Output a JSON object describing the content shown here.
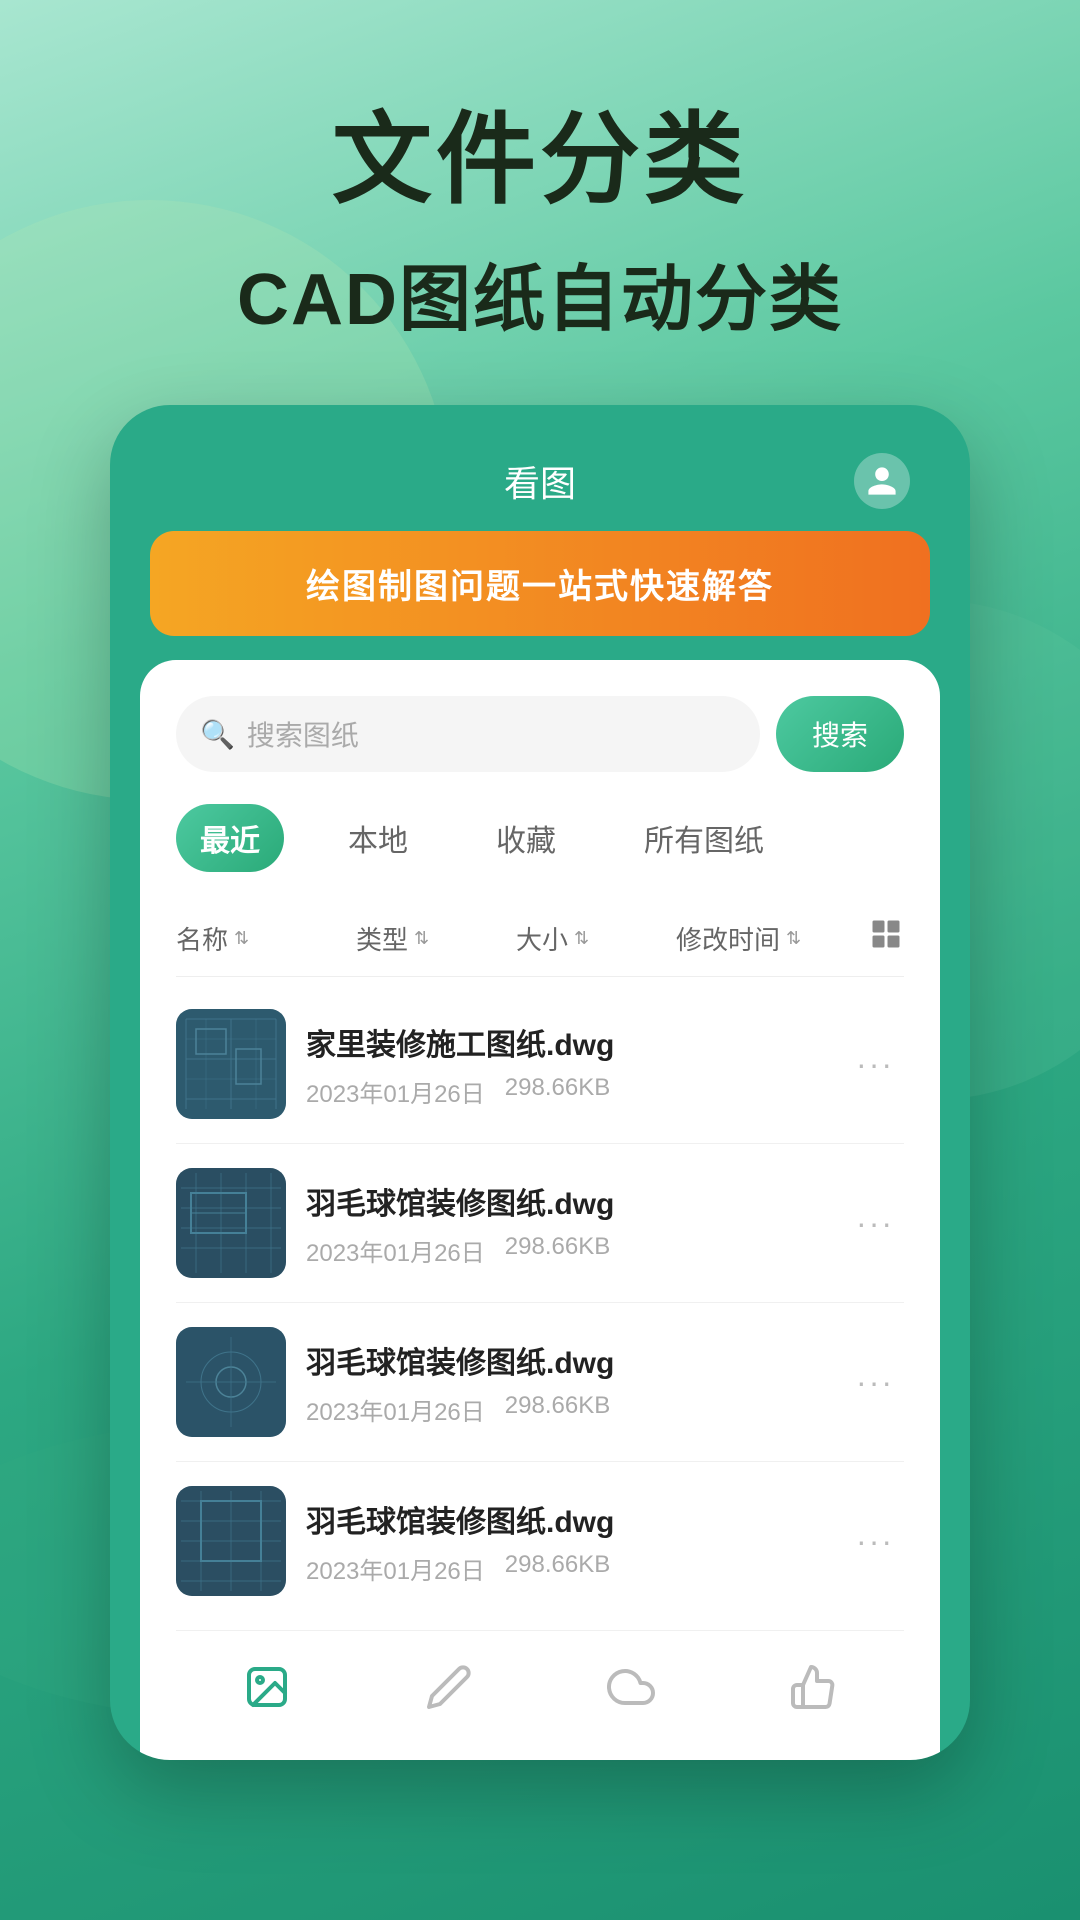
{
  "background": {
    "gradient_start": "#a8e6d0",
    "gradient_end": "#1a9070"
  },
  "title_section": {
    "main_title": "文件分类",
    "sub_title": "CAD图纸自动分类"
  },
  "app": {
    "header_title": "看图",
    "avatar_label": "用户头像"
  },
  "banner": {
    "text": "绘图制图问题一站式快速解答"
  },
  "search": {
    "placeholder": "搜索图纸",
    "button_label": "搜索"
  },
  "tabs": [
    {
      "id": "recent",
      "label": "最近",
      "active": true
    },
    {
      "id": "local",
      "label": "本地",
      "active": false
    },
    {
      "id": "favorite",
      "label": "收藏",
      "active": false
    },
    {
      "id": "all",
      "label": "所有图纸",
      "active": false
    }
  ],
  "sort_bar": {
    "columns": [
      {
        "id": "name",
        "label": "名称"
      },
      {
        "id": "type",
        "label": "类型"
      },
      {
        "id": "size",
        "label": "大小"
      },
      {
        "id": "modified",
        "label": "修改时间"
      }
    ],
    "grid_icon": "grid-view"
  },
  "files": [
    {
      "id": 1,
      "name": "家里装修施工图纸.dwg",
      "date": "2023年01月26日",
      "size": "298.66KB"
    },
    {
      "id": 2,
      "name": "羽毛球馆装修图纸.dwg",
      "date": "2023年01月26日",
      "size": "298.66KB"
    },
    {
      "id": 3,
      "name": "羽毛球馆装修图纸.dwg",
      "date": "2023年01月26日",
      "size": "298.66KB"
    },
    {
      "id": 4,
      "name": "羽毛球馆装修图纸.dwg",
      "date": "2023年01月26日",
      "size": "298.66KB"
    }
  ],
  "bottom_nav": [
    {
      "id": "gallery",
      "label": "图库",
      "active": true
    },
    {
      "id": "edit",
      "label": "编辑",
      "active": false
    },
    {
      "id": "cloud",
      "label": "云端",
      "active": false
    },
    {
      "id": "thumb",
      "label": "手势",
      "active": false
    }
  ],
  "colors": {
    "primary": "#2aaa88",
    "accent": "#f07020",
    "active_tab_bg": "#4dc9a0"
  }
}
